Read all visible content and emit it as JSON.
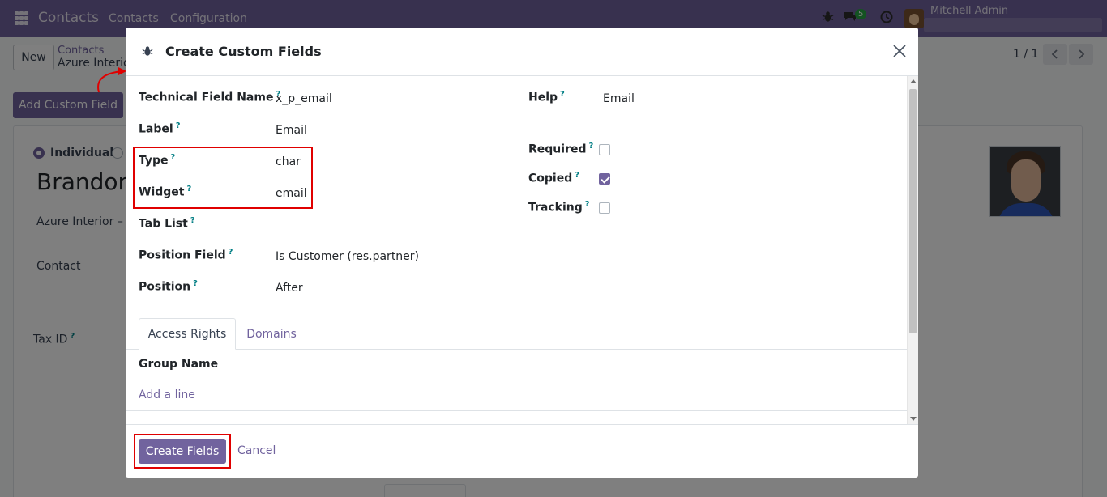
{
  "navbar": {
    "app_name": "Contacts",
    "menu": [
      "Contacts",
      "Configuration"
    ],
    "message_count": "5",
    "user_name": "Mitchell Admin"
  },
  "control_panel": {
    "new_label": "New",
    "breadcrumb_parent": "Contacts",
    "breadcrumb_current": "Azure Interio",
    "pager": "1 / 1",
    "add_custom_field_label": "Add Custom Field"
  },
  "form": {
    "individual_label": "Individual",
    "partner_name": "Brandon",
    "company": "Azure Interior – U",
    "contact_label": "Contact",
    "tax_id_label": "Tax ID",
    "help_mark": "?"
  },
  "modal": {
    "title": "Create Custom Fields",
    "left_fields": [
      {
        "label": "Technical Field Name",
        "value": "x_p_email"
      },
      {
        "label": "Label",
        "value": "Email"
      },
      {
        "label": "Type",
        "value": "char"
      },
      {
        "label": "Widget",
        "value": "email"
      },
      {
        "label": "Tab List",
        "value": ""
      },
      {
        "label": "Position Field",
        "value": "Is Customer (res.partner)"
      },
      {
        "label": "Position",
        "value": "After"
      }
    ],
    "help": {
      "label": "Help",
      "value": "Email"
    },
    "checkboxes": [
      {
        "label": "Required",
        "checked": false
      },
      {
        "label": "Copied",
        "checked": true
      },
      {
        "label": "Tracking",
        "checked": false
      }
    ],
    "tabs": [
      "Access Rights",
      "Domains"
    ],
    "list_header": "Group Name",
    "add_line": "Add a line",
    "create_label": "Create Fields",
    "cancel_label": "Cancel"
  },
  "colors": {
    "brand": "#71639e",
    "highlight": "#e00000",
    "badge": "#28a745"
  }
}
